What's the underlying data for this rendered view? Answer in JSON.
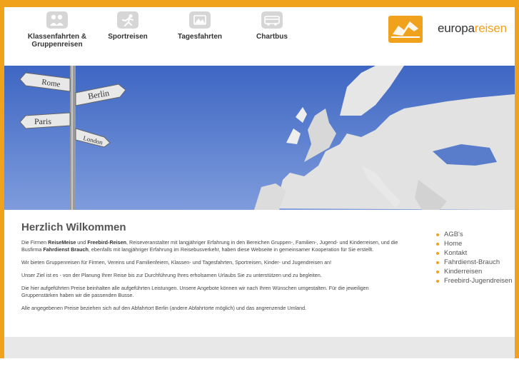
{
  "nav": [
    {
      "label": "Klassenfahrten &\nGruppenreisen",
      "icon": "group-icon"
    },
    {
      "label": "Sportreisen",
      "icon": "sport-icon"
    },
    {
      "label": "Tagesfahrten",
      "icon": "daytrip-icon"
    },
    {
      "label": "Chartbus",
      "icon": "bus-icon"
    }
  ],
  "logo": {
    "part1": "europa",
    "part2": "reisen"
  },
  "banner": {
    "signs": [
      "Rome",
      "Berlin",
      "Paris",
      "London"
    ]
  },
  "main": {
    "title": "Herzlich Wilkommen",
    "p1_a": "Die Firmen ",
    "p1_b": "ReiseMeise",
    "p1_c": " und ",
    "p1_d": "Freebird-Reisen",
    "p1_e": ", Reiseveranstalter mit langjähriger Erfahrung in den Bereichen Gruppen-, Familien-, Jugend- und Kinderreisen, und die Busfirma ",
    "p1_f": "Fahrdienst Brauch",
    "p1_g": ", ebenfalls mit langjähriger Erfahrung im Reisebusverkehr, haben diese Webseite in gemeinsamer Kooperation für Sie erstellt.",
    "p2": "Wir bieten Gruppenreisen für Firmen, Vereins und Familienfeiern, Klassen- und Tagesfahrten, Sportreisen, Kinder- und Jugendreisen an!",
    "p3": "Unser Ziel ist es - von der Planung Ihrer Reise bis zur Durchführung Ihres erholsamen Urlaubs Sie zu unterstützen und zu begleiten.",
    "p4": "Die hier aufgeführten Preise beinhalten alle aufgeführten Leistungen. Unsere Angebote können wir nach Ihren Wünschen umgestalten. Für die jeweiligen Gruppenstärken haben wir die passenden Busse.",
    "p5": "Alle angegebenen Preise beziehen sich auf den Abfahrtort Berlin (andere Abfahrtorte möglich) und das angrenzende Umland."
  },
  "side_links": [
    "AGB's",
    "Home",
    "Kontakt",
    "Fahrdienst-Brauch",
    "Kinderreisen",
    "Freebird-Jugendreisen"
  ],
  "colors": {
    "accent": "#f0a21d",
    "sea": "#4a72c8",
    "land": "#e2e2e2"
  }
}
